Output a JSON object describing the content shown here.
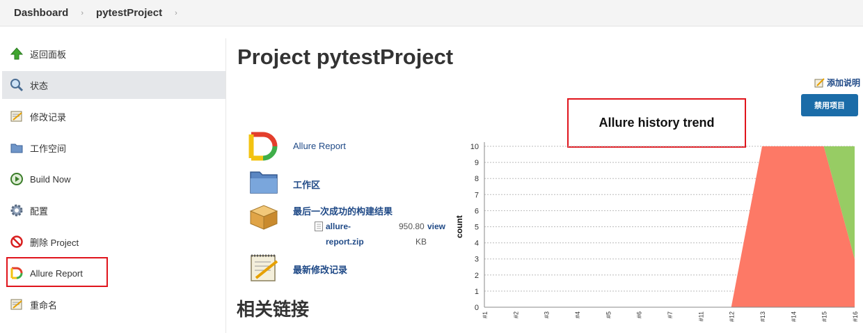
{
  "breadcrumb": {
    "items": [
      "Dashboard",
      "pytestProject"
    ],
    "separator": "›"
  },
  "sidebar": {
    "items": [
      {
        "label": "返回面板",
        "icon": "up-arrow-icon"
      },
      {
        "label": "状态",
        "icon": "magnifier-icon",
        "active": true
      },
      {
        "label": "修改记录",
        "icon": "notepad-icon"
      },
      {
        "label": "工作空间",
        "icon": "folder-icon"
      },
      {
        "label": "Build Now",
        "icon": "build-now-icon"
      },
      {
        "label": "配置",
        "icon": "gear-icon"
      },
      {
        "label": "删除 Project",
        "icon": "prohibited-icon"
      },
      {
        "label": "Allure Report",
        "icon": "allure-logo-icon",
        "highlighted": true
      },
      {
        "label": "重命名",
        "icon": "notepad-icon"
      }
    ]
  },
  "main": {
    "title": "Project pytestProject",
    "add_description": "添加说明",
    "disable_button": "禁用项目",
    "links": [
      {
        "label": "Allure Report",
        "icon": "allure-logo-icon"
      },
      {
        "label": "工作区",
        "icon": "folder-icon"
      },
      {
        "label": "最后一次成功的构建结果",
        "icon": "package-icon"
      },
      {
        "label": "最新修改记录",
        "icon": "notepad-icon"
      }
    ],
    "artifact": {
      "name_line1": "allure-",
      "name_line2": "report.zip",
      "size_line1": "950.80",
      "size_line2": "KB",
      "view": "view"
    },
    "related_links": "相关链接"
  },
  "colors": {
    "failed": "#fd7966",
    "passed": "#97cc64",
    "link": "#204a87",
    "highlight_border": "#e0141c",
    "button": "#1b6ca8"
  },
  "chart_data": {
    "type": "area",
    "title": "Allure history trend",
    "ylabel": "count",
    "xlabel": "",
    "categories": [
      "#1",
      "#2",
      "#3",
      "#4",
      "#5",
      "#6",
      "#7",
      "#11",
      "#12",
      "#13",
      "#14",
      "#15",
      "#16"
    ],
    "ylim": [
      0,
      10
    ],
    "yticks": [
      0,
      1,
      2,
      3,
      4,
      5,
      6,
      7,
      8,
      9,
      10
    ],
    "grid": true,
    "series": [
      {
        "values": [
          0,
          0,
          0,
          0,
          0,
          0,
          0,
          0,
          0,
          10,
          10,
          10,
          3
        ],
        "color": "#fd7966"
      },
      {
        "values": [
          0,
          0,
          0,
          0,
          0,
          0,
          0,
          0,
          0,
          0,
          0,
          0,
          7
        ],
        "color": "#97cc64"
      }
    ]
  }
}
